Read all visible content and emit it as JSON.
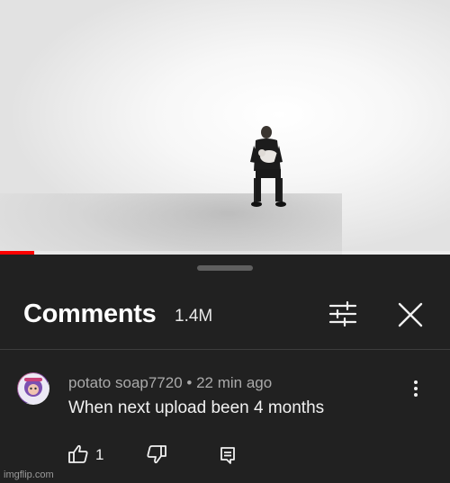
{
  "video": {
    "progress_fraction": 0.075,
    "progress_color": "#ff0000"
  },
  "comments_sheet": {
    "title": "Comments",
    "count": "1.4M",
    "filter_icon": "sliders-icon",
    "close_icon": "close-icon"
  },
  "comment": {
    "author": "potato soap7720",
    "separator": "•",
    "time": "22 min ago",
    "text": "When next upload been 4 months",
    "likes": "1",
    "more_icon": "vertical-dots-icon",
    "like_icon": "thumbs-up-icon",
    "dislike_icon": "thumbs-down-icon",
    "reply_icon": "reply-icon"
  },
  "watermark": "imgflip.com"
}
